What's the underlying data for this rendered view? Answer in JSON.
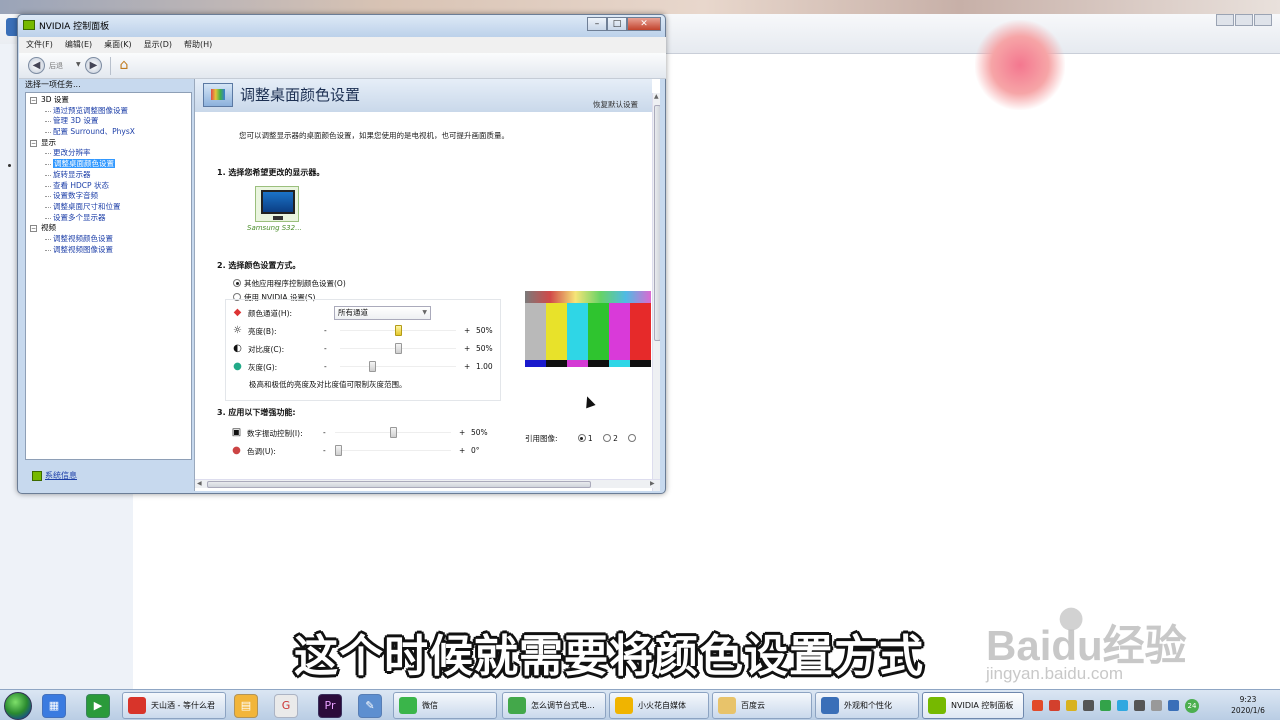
{
  "window": {
    "title": "NVIDIA 控制面板",
    "menu": [
      "文件(F)",
      "编辑(E)",
      "桌面(K)",
      "显示(D)",
      "帮助(H)"
    ],
    "back_label": "后退",
    "task_header": "选择一项任务...",
    "tree": [
      {
        "type": "cat",
        "label": "3D 设置"
      },
      {
        "type": "leaf",
        "label": "通过预览调整图像设置"
      },
      {
        "type": "leaf",
        "label": "管理 3D 设置"
      },
      {
        "type": "leaf",
        "label": "配置 Surround、PhysX"
      },
      {
        "type": "cat",
        "label": "显示"
      },
      {
        "type": "leaf",
        "label": "更改分辨率"
      },
      {
        "type": "leaf",
        "label": "调整桌面颜色设置",
        "selected": true
      },
      {
        "type": "leaf",
        "label": "旋转显示器"
      },
      {
        "type": "leaf",
        "label": "查看 HDCP 状态"
      },
      {
        "type": "leaf",
        "label": "设置数字音频"
      },
      {
        "type": "leaf",
        "label": "调整桌面尺寸和位置"
      },
      {
        "type": "leaf",
        "label": "设置多个显示器"
      },
      {
        "type": "cat",
        "label": "视频"
      },
      {
        "type": "leaf",
        "label": "调整视频颜色设置"
      },
      {
        "type": "leaf",
        "label": "调整视频图像设置"
      }
    ],
    "system_info": "系统信息"
  },
  "page": {
    "title": "调整桌面颜色设置",
    "restore_defaults": "恢复默认设置",
    "description": "您可以调整显示器的桌面颜色设置，如果您使用的是电视机，也可提升画面质量。",
    "section1": "1. 选择您希望更改的显示器。",
    "monitor_name": "Samsung S32...",
    "section2": "2. 选择颜色设置方式。",
    "radio_other_app": "其他应用程序控制颜色设置(O)",
    "radio_nvidia": "使用 NVIDIA 设置(S)",
    "radio_selected": "other_app",
    "channel_label": "颜色通道(H):",
    "channel_value": "所有通道",
    "brightness_label": "亮度(B):",
    "brightness_value": "50%",
    "brightness_level": 0.5,
    "contrast_label": "对比度(C):",
    "contrast_value": "50%",
    "contrast_level": 0.5,
    "gamma_label": "灰度(G):",
    "gamma_value": "1.00",
    "gamma_level": 0.27,
    "range_note": "极高和极低的亮度及对比度值可限制灰度范围。",
    "section3": "3. 应用以下增强功能:",
    "vibrance_label": "数字振动控制(I):",
    "vibrance_value": "50%",
    "vibrance_level": 0.5,
    "hue_label": "色调(U):",
    "hue_value": "0°",
    "hue_level": 0.0,
    "minus": "-",
    "plus": "+",
    "ref_label": "引用图像:",
    "ref_options": [
      "1",
      "2"
    ],
    "ref_selected": "1"
  },
  "test_pattern": {
    "bars": [
      "#b9b9b9",
      "#e8e22a",
      "#2fd6e6",
      "#2fc42f",
      "#d93ad9",
      "#e62a2a"
    ],
    "mid": [
      "#1a1acc",
      "#101010",
      "#d43ad4",
      "#101010",
      "#2fd6e6",
      "#101010"
    ],
    "bottom": [
      "#0e3a5a",
      "#ffffff",
      "#3a0f6e",
      "#111111"
    ]
  },
  "subtitle": "这个时候就需要将颜色设置方式",
  "watermark": {
    "brand": "Baidu经验",
    "url": "jingyan.baidu.com"
  },
  "taskbar": {
    "buttons": [
      {
        "label": "天山酒 - 等什么君",
        "color": "#d8342a"
      },
      {
        "label": "微信",
        "color": "#3ab54a"
      },
      {
        "label": "怎么调节台式电...",
        "color": "#43a84a"
      },
      {
        "label": "小火花自媒体",
        "color": "#f0b400"
      },
      {
        "label": "百度云",
        "color": "#e8c36a"
      },
      {
        "label": "外观和个性化",
        "color": "#3a6fb8"
      },
      {
        "label": "NVIDIA 控制面板",
        "color": "#76b900",
        "active": true
      }
    ],
    "time": "9:23",
    "date": "2020/1/6",
    "badge": "24"
  }
}
